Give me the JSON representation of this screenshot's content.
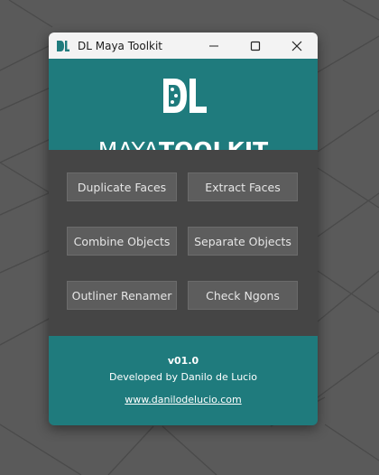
{
  "window": {
    "title": "DL Maya Toolkit"
  },
  "header": {
    "brand_light": "MAYA",
    "brand_bold": "TOOLKIT"
  },
  "buttons": [
    {
      "label": "Duplicate Faces"
    },
    {
      "label": "Extract Faces"
    },
    {
      "label": "Combine Objects"
    },
    {
      "label": "Separate Objects"
    },
    {
      "label": "Outliner Renamer"
    },
    {
      "label": "Check Ngons"
    }
  ],
  "footer": {
    "version": "v01.0",
    "credit": "Developed by Danilo de Lucio",
    "website": "www.danilodelucio.com"
  },
  "colors": {
    "accent": "#1f7b7d",
    "panel": "#454545",
    "button": "#5d5d5d",
    "viewport": "#5a5a5a"
  },
  "icons": {
    "title_logo": "dl-logo-icon",
    "minimize": "minimize-icon",
    "maximize": "maximize-icon",
    "close": "close-icon"
  }
}
